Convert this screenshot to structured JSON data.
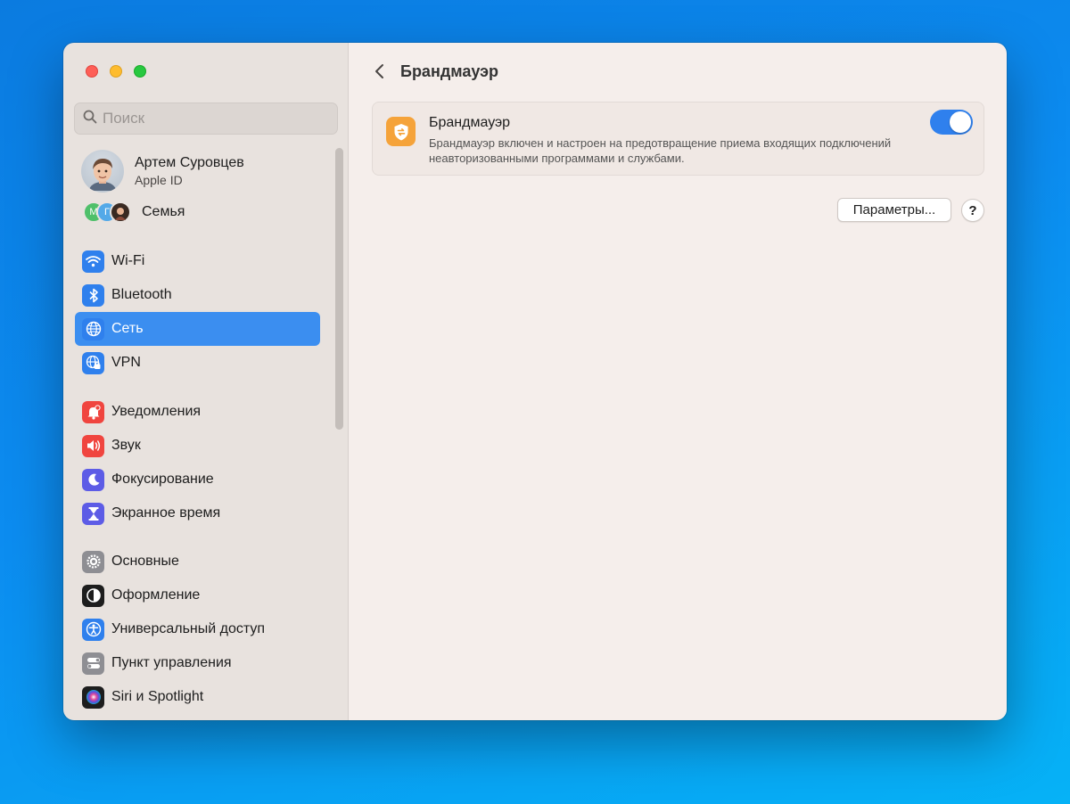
{
  "window": {
    "traffic_lights": [
      "close",
      "minimize",
      "zoom"
    ]
  },
  "sidebar": {
    "search": {
      "placeholder": "Поиск",
      "value": ""
    },
    "profile": {
      "name": "Артем Суровцев",
      "subtitle": "Apple ID"
    },
    "family": {
      "label": "Семья",
      "member_initials": [
        "М",
        "Г"
      ]
    },
    "items": [
      {
        "label": "Wi-Fi",
        "icon": "wifi-icon",
        "color": "#2f80ed",
        "active": false
      },
      {
        "label": "Bluetooth",
        "icon": "bluetooth-icon",
        "color": "#2f80ed",
        "active": false
      },
      {
        "label": "Сеть",
        "icon": "globe-icon",
        "color": "#2f80ed",
        "active": true
      },
      {
        "label": "VPN",
        "icon": "globe-vpn-icon",
        "color": "#2f80ed",
        "active": false
      },
      {
        "label": "Уведомления",
        "icon": "bell-icon",
        "color": "#f0453f",
        "active": false
      },
      {
        "label": "Звук",
        "icon": "speaker-icon",
        "color": "#f0453f",
        "active": false
      },
      {
        "label": "Фокусирование",
        "icon": "moon-icon",
        "color": "#5d5ce6",
        "active": false
      },
      {
        "label": "Экранное время",
        "icon": "hourglass-icon",
        "color": "#5d5ce6",
        "active": false
      },
      {
        "label": "Основные",
        "icon": "gear-icon",
        "color": "#8e8e93",
        "active": false
      },
      {
        "label": "Оформление",
        "icon": "appearance-icon",
        "color": "#1d1d1d",
        "active": false
      },
      {
        "label": "Универсальный доступ",
        "icon": "accessibility-icon",
        "color": "#2f80ed",
        "active": false
      },
      {
        "label": "Пункт управления",
        "icon": "control-center-icon",
        "color": "#8e8e93",
        "active": false
      },
      {
        "label": "Siri и Spotlight",
        "icon": "siri-icon",
        "color": "#1d1d1d",
        "active": false
      }
    ]
  },
  "main": {
    "title": "Брандмауэр",
    "firewall": {
      "title": "Брандмауэр",
      "description": "Брандмауэр включен и настроен на предотвращение приема входящих подключений неавторизованными программами и службами.",
      "enabled": true,
      "icon_color": "#f5a33a"
    },
    "options_button": "Параметры...",
    "help_button": "?"
  },
  "colors": {
    "accent": "#3b8ef0",
    "toggle_on": "#2f80ed"
  }
}
